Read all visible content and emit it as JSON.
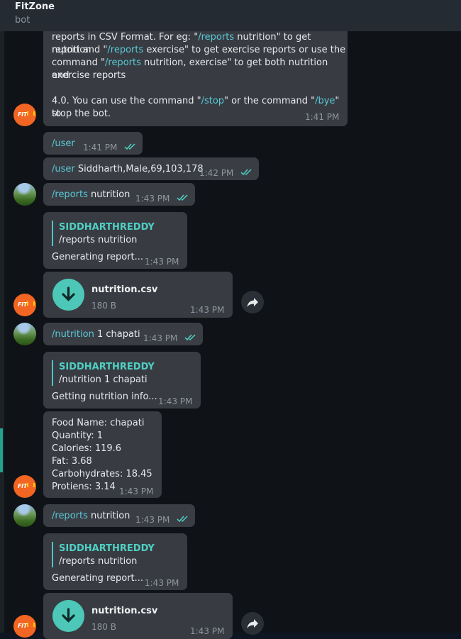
{
  "header": {
    "title": "FitZone",
    "subtitle": "bot"
  },
  "colors": {
    "accent": "#4fd0c4",
    "link": "#59c8d8",
    "bubble": "#383c42",
    "bot_avatar": "#f26522"
  },
  "messages": {
    "m1": {
      "line1a": "reports in CSV Format. For eg: \"",
      "line1b": "/reports",
      "line1c": " nutrition\" to get nutrition",
      "line2a": "report and \"",
      "line2b": "/reports",
      "line2c": " exercise\" to get exercise reports or use the",
      "line3a": "command \"",
      "line3b": "/reports",
      "line3c": " nutrition, exercise\" to get both nutrition and",
      "line4": "exercise reports",
      "line5a": "4.0. You can use the command \"",
      "line5b": "/stop",
      "line5c": "\" or the command \"",
      "line5d": "/bye",
      "line5e": "\" to",
      "line6": "stop the bot.",
      "time": "1:41 PM"
    },
    "m2": {
      "cmd": "/user",
      "time": "1:41 PM"
    },
    "m3": {
      "cmd": "/user",
      "text": " Siddharth,Male,69,103,178",
      "time": "1:42 PM"
    },
    "m4": {
      "cmd": "/reports",
      "text": " nutrition",
      "time": "1:43 PM"
    },
    "m5": {
      "quote_name": "SIDDHARTHREDDY",
      "quote_text": "/reports nutrition",
      "text": "Generating report...",
      "time": "1:43 PM"
    },
    "m6": {
      "file_name": "nutrition.csv",
      "file_size": "180 B",
      "time": "1:43 PM"
    },
    "m7": {
      "cmd": "/nutrition",
      "text": " 1 chapati",
      "time": "1:43 PM"
    },
    "m8": {
      "quote_name": "SIDDHARTHREDDY",
      "quote_text": "/nutrition 1 chapati",
      "text": "Getting nutrition info...",
      "time": "1:43 PM"
    },
    "m9": {
      "l1": "Food Name: chapati",
      "l2": "Quantity: 1",
      "l3": "Calories: 119.6",
      "l4": "Fat: 3.68",
      "l5": "Carbohydrates: 18.45",
      "l6": "Protiens: 3.14",
      "time": "1:43 PM"
    },
    "m10": {
      "cmd": "/reports",
      "text": " nutrition",
      "time": "1:43 PM"
    },
    "m11": {
      "quote_name": "SIDDHARTHREDDY",
      "quote_text": "/reports nutrition",
      "text": "Generating report...",
      "time": "1:43 PM"
    },
    "m12": {
      "file_name": "nutrition.csv",
      "file_size": "180 B",
      "time": "1:43 PM"
    }
  },
  "avatars": {
    "bot_logo": "FIT"
  },
  "icons": {
    "download": "download-arrow-icon",
    "share": "share-forward-icon",
    "read": "double-check-icon"
  }
}
